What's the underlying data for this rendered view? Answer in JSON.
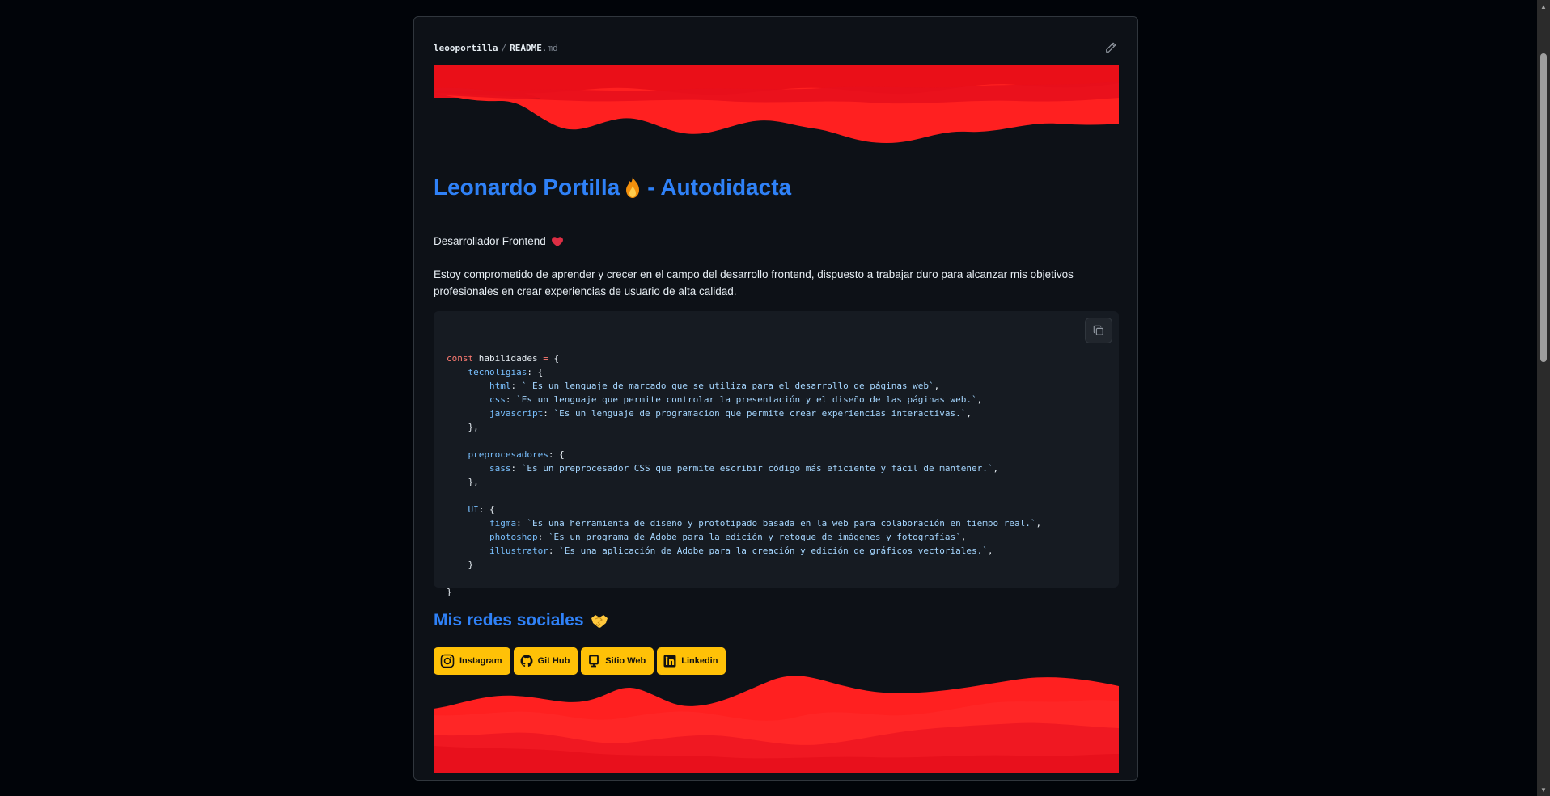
{
  "file": {
    "owner": "leooportilla",
    "separator": "/",
    "name": "README",
    "ext": ".md"
  },
  "heading": {
    "name": "Leonardo Portilla",
    "suffix": " - Autodidacta"
  },
  "subtitle": "Desarrollador Frontend",
  "description": "Estoy comprometido de aprender y crecer en el campo del desarrollo frontend, dispuesto a trabajar duro para alcanzar mis objetivos profesionales en crear experiencias de usuario de alta calidad.",
  "code": {
    "lines": [
      [
        [
          "kw",
          "const "
        ],
        [
          "txt",
          "habilidades "
        ],
        [
          "kw",
          "= "
        ],
        [
          "txt",
          "{"
        ]
      ],
      [
        [
          "txt",
          "    "
        ],
        [
          "prop",
          "tecnoligias"
        ],
        [
          "txt",
          ": {"
        ]
      ],
      [
        [
          "txt",
          "        "
        ],
        [
          "prop",
          "html"
        ],
        [
          "txt",
          ": "
        ],
        [
          "str",
          "` Es un lenguaje de marcado que se utiliza para el desarrollo de páginas web`"
        ],
        [
          "txt",
          ","
        ]
      ],
      [
        [
          "txt",
          "        "
        ],
        [
          "prop",
          "css"
        ],
        [
          "txt",
          ": "
        ],
        [
          "str",
          "`Es un lenguaje que permite controlar la presentación y el diseño de las páginas web.`"
        ],
        [
          "txt",
          ","
        ]
      ],
      [
        [
          "txt",
          "        "
        ],
        [
          "prop",
          "javascript"
        ],
        [
          "txt",
          ": "
        ],
        [
          "str",
          "`Es un lenguaje de programacion que permite crear experiencias interactivas.`"
        ],
        [
          "txt",
          ","
        ]
      ],
      [
        [
          "txt",
          "    },"
        ]
      ],
      [
        [
          "txt",
          ""
        ]
      ],
      [
        [
          "txt",
          "    "
        ],
        [
          "prop",
          "preprocesadores"
        ],
        [
          "txt",
          ": {"
        ]
      ],
      [
        [
          "txt",
          "        "
        ],
        [
          "prop",
          "sass"
        ],
        [
          "txt",
          ": "
        ],
        [
          "str",
          "`Es un preprocesador CSS que permite escribir código más eficiente y fácil de mantener.`"
        ],
        [
          "txt",
          ","
        ]
      ],
      [
        [
          "txt",
          "    },"
        ]
      ],
      [
        [
          "txt",
          ""
        ]
      ],
      [
        [
          "txt",
          "    "
        ],
        [
          "prop",
          "UI"
        ],
        [
          "txt",
          ": {"
        ]
      ],
      [
        [
          "txt",
          "        "
        ],
        [
          "prop",
          "figma"
        ],
        [
          "txt",
          ": "
        ],
        [
          "str",
          "`Es una herramienta de diseño y prototipado basada en la web para colaboración en tiempo real.`"
        ],
        [
          "txt",
          ","
        ]
      ],
      [
        [
          "txt",
          "        "
        ],
        [
          "prop",
          "photoshop"
        ],
        [
          "txt",
          ": "
        ],
        [
          "str",
          "`Es un programa de Adobe para la edición y retoque de imágenes y fotografías`"
        ],
        [
          "txt",
          ","
        ]
      ],
      [
        [
          "txt",
          "        "
        ],
        [
          "prop",
          "illustrator"
        ],
        [
          "txt",
          ": "
        ],
        [
          "str",
          "`Es una aplicación de Adobe para la creación y edición de gráficos vectoriales.`"
        ],
        [
          "txt",
          ","
        ]
      ],
      [
        [
          "txt",
          "    }"
        ]
      ],
      [
        [
          "txt",
          ""
        ]
      ],
      [
        [
          "txt",
          "}"
        ]
      ]
    ]
  },
  "social": {
    "heading": "Mis redes sociales",
    "badges": [
      {
        "label": "Instagram",
        "icon": "instagram-icon"
      },
      {
        "label": "Git Hub",
        "icon": "github-icon"
      },
      {
        "label": "Sitio Web",
        "icon": "website-icon"
      },
      {
        "label": "Linkedin",
        "icon": "linkedin-icon"
      }
    ]
  },
  "colors": {
    "background": "#010409",
    "card": "#0d1117",
    "accent": "#2f81f7",
    "wave_dark": "#e8101c",
    "wave_light": "#ff2020",
    "badge": "#ffc107"
  }
}
